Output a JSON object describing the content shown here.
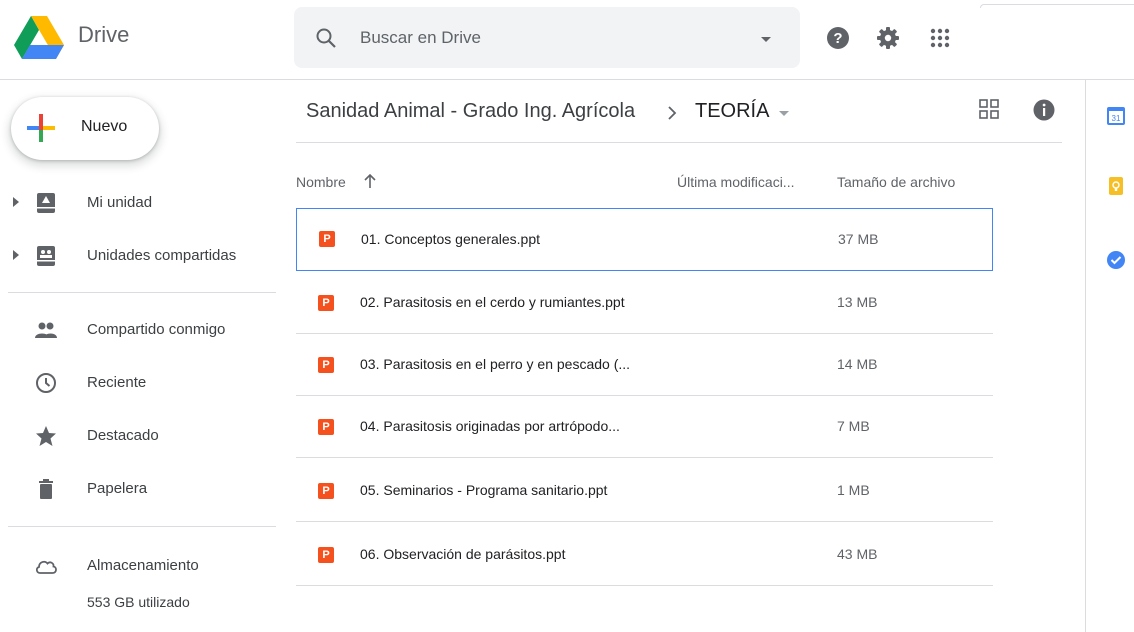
{
  "app": {
    "name": "Drive",
    "logo_icon": "google-drive-logo"
  },
  "search": {
    "placeholder": "Buscar en Drive",
    "icon": "search-icon"
  },
  "header_icons": [
    "help-icon",
    "settings-icon",
    "apps-grid-icon"
  ],
  "sidebar": {
    "new_button_label": "Nuevo",
    "items": [
      {
        "label": "Mi unidad",
        "icon": "my-drive-icon",
        "expandable": true
      },
      {
        "label": "Unidades compartidas",
        "icon": "shared-drives-icon",
        "expandable": true
      },
      {
        "label": "Compartido conmigo",
        "icon": "shared-with-me-icon"
      },
      {
        "label": "Reciente",
        "icon": "recent-icon"
      },
      {
        "label": "Destacado",
        "icon": "star-icon"
      },
      {
        "label": "Papelera",
        "icon": "trash-icon"
      },
      {
        "label": "Almacenamiento",
        "icon": "cloud-icon"
      }
    ],
    "storage_used": "553 GB utilizado"
  },
  "breadcrumb": {
    "parent": "Sanidad Animal - Grado Ing. Agrícola",
    "current": "TEORÍA"
  },
  "columns": {
    "name": "Nombre",
    "modified": "Última modificaci...",
    "size": "Tamaño de archivo"
  },
  "files": [
    {
      "icon_letter": "P",
      "name": "01. Conceptos generales.ppt",
      "size": "37 MB",
      "selected": true
    },
    {
      "icon_letter": "P",
      "name": "02. Parasitosis en el cerdo y rumiantes.ppt",
      "size": "13 MB"
    },
    {
      "icon_letter": "P",
      "name": "03. Parasitosis en el perro y en pescado (...",
      "size": "14 MB"
    },
    {
      "icon_letter": "P",
      "name": "04. Parasitosis originadas por artrópodo...",
      "size": "7 MB"
    },
    {
      "icon_letter": "P",
      "name": "05. Seminarios - Programa sanitario.ppt",
      "size": "1 MB"
    },
    {
      "icon_letter": "P",
      "name": "06. Observación de parásitos.ppt",
      "size": "43 MB"
    }
  ],
  "side_panel": {
    "calendar_text": "31",
    "icons": [
      "calendar-icon",
      "keep-icon",
      "tasks-icon"
    ]
  },
  "colors": {
    "accent_blue": "#4285f4",
    "ppt_orange": "#f4511e",
    "keep_yellow": "#f6bf26",
    "tasks_blue": "#4285f4"
  }
}
